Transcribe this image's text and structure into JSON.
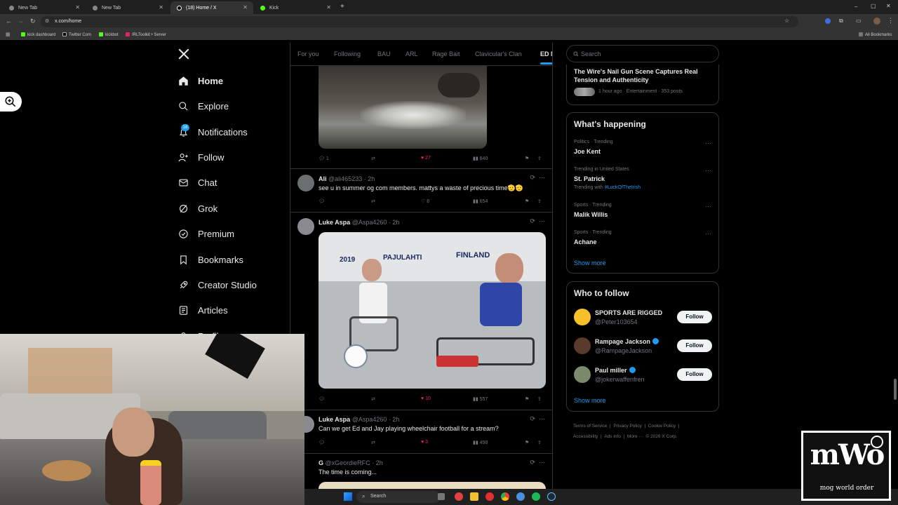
{
  "browser": {
    "tabs": [
      {
        "title": "New Tab"
      },
      {
        "title": "New Tab"
      },
      {
        "title": "(18) Home / X"
      },
      {
        "title": "Kick"
      }
    ],
    "url": "x.com/home",
    "bookmarks": [
      "kick dashboard",
      "Twitter Com",
      "kickbot",
      "IRLToolkit • Server"
    ],
    "all_bookmarks": "All Bookmarks"
  },
  "nav": {
    "items": [
      {
        "label": "Home",
        "icon": "home-icon"
      },
      {
        "label": "Explore",
        "icon": "search-icon"
      },
      {
        "label": "Notifications",
        "icon": "bell-icon",
        "badge": "18"
      },
      {
        "label": "Follow",
        "icon": "person-add-icon"
      },
      {
        "label": "Chat",
        "icon": "mail-icon"
      },
      {
        "label": "Grok",
        "icon": "grok-icon"
      },
      {
        "label": "Premium",
        "icon": "premium-icon"
      },
      {
        "label": "Bookmarks",
        "icon": "bookmark-icon"
      },
      {
        "label": "Creator Studio",
        "icon": "rocket-icon"
      },
      {
        "label": "Articles",
        "icon": "article-icon"
      },
      {
        "label": "Profile",
        "icon": "person-icon"
      }
    ]
  },
  "feed_tabs": [
    "For you",
    "Following",
    "BAU",
    "ARL",
    "Rage Bait",
    "Clavicular's Clan",
    "ED M"
  ],
  "posts": [
    {
      "replies": "1",
      "likes": "27",
      "views": "840"
    },
    {
      "name": "Ali",
      "handle": "@ali465233",
      "time": "2h",
      "text": "see u in summer og com members. mattys a waste of precious time🫡🫡",
      "likes": "8",
      "views": "654"
    },
    {
      "name": "Luke Aspa",
      "handle": "@Aspa4260",
      "time": "2h",
      "likes": "10",
      "views": "557",
      "image_text": {
        "year": "2019",
        "banner1": "PAJULAHTI",
        "banner2": "FINLAND"
      }
    },
    {
      "name": "Luke Aspa",
      "handle": "@Aspa4260",
      "time": "2h",
      "text": "Can we get Ed and Jay playing wheelchair football for a stream?",
      "likes": "3",
      "views": "498"
    },
    {
      "name": "G",
      "handle": "@xGeordieRFC",
      "time": "2h",
      "text": "The time is coming..."
    }
  ],
  "sidebar": {
    "search_placeholder": "Search",
    "news": {
      "headline": "The Wire's Nail Gun Scene Captures Real Tension and Authenticity",
      "meta": "1 hour ago · Entertainment · 353 posts"
    },
    "happening_title": "What's happening",
    "trends": [
      {
        "meta": "Politics · Trending",
        "name": "Joe Kent"
      },
      {
        "meta": "Trending in United States",
        "name": "St. Patrick",
        "with": "Trending with",
        "hashtag": "#LuckOfTheIrish"
      },
      {
        "meta": "Sports · Trending",
        "name": "Malik Willis"
      },
      {
        "meta": "Sports · Trending",
        "name": "Achane"
      }
    ],
    "show_more": "Show more",
    "who_title": "Who to follow",
    "who": [
      {
        "name": "SPORTS ARE RIGGED",
        "handle": "@Peter103654",
        "verified": false
      },
      {
        "name": "Rampage Jackson",
        "handle": "@RampageJackson",
        "verified": true
      },
      {
        "name": "Paul miller",
        "handle": "@jokerwaffenfren",
        "verified": true
      }
    ],
    "follow_label": "Follow",
    "footer": [
      "Terms of Service",
      "|",
      "Privacy Policy",
      "|",
      "Cookie Policy",
      "|",
      "Accessibility",
      "|",
      "Ads info",
      "|",
      "More ···",
      "© 2026 X Corp."
    ]
  },
  "taskbar": {
    "search": "Search"
  },
  "watermark": {
    "text": "mWo",
    "sub": "mog world order"
  },
  "colors": {
    "accent": "#1d9bf0",
    "like": "#f91880",
    "border": "#2f3336"
  }
}
